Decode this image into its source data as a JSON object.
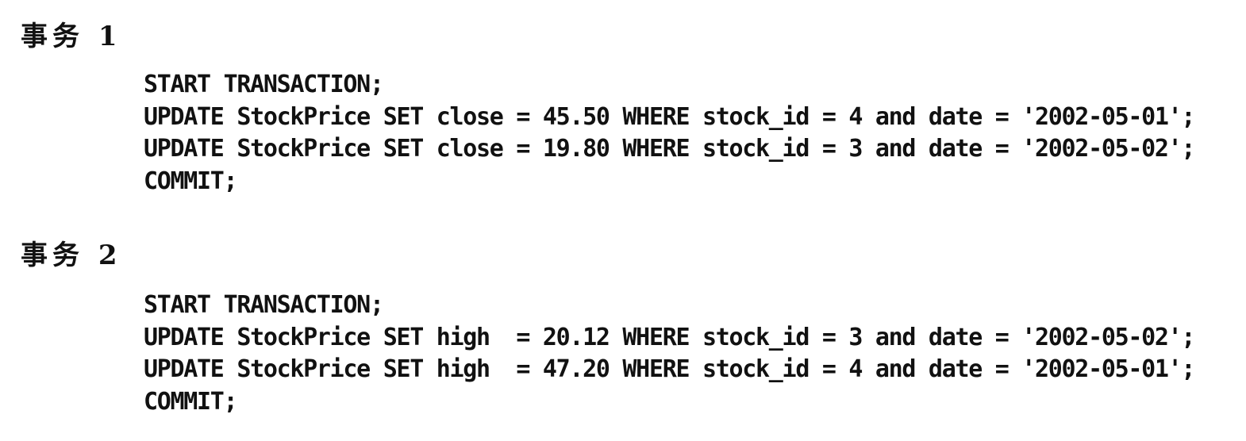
{
  "transactions": [
    {
      "heading": "事务 1",
      "lines": [
        "START TRANSACTION;",
        "UPDATE StockPrice SET close = 45.50 WHERE stock_id = 4 and date = '2002-05-01';",
        "UPDATE StockPrice SET close = 19.80 WHERE stock_id = 3 and date = '2002-05-02';",
        "COMMIT;"
      ]
    },
    {
      "heading": "事务 2",
      "lines": [
        "START TRANSACTION;",
        "UPDATE StockPrice SET high  = 20.12 WHERE stock_id = 3 and date = '2002-05-02';",
        "UPDATE StockPrice SET high  = 47.20 WHERE stock_id = 4 and date = '2002-05-01';",
        "COMMIT;"
      ]
    }
  ]
}
